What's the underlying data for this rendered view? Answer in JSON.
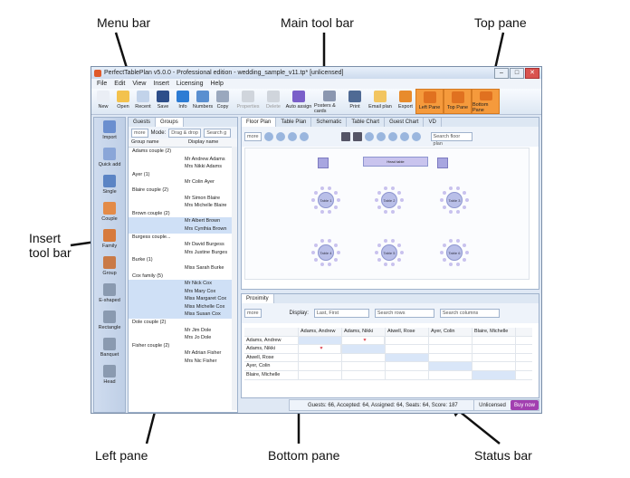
{
  "callouts": {
    "menu_bar": "Menu bar",
    "main_tool_bar": "Main tool bar",
    "top_pane": "Top pane",
    "insert_tool_bar_1": "Insert",
    "insert_tool_bar_2": "tool bar",
    "left_pane": "Left pane",
    "bottom_pane": "Bottom pane",
    "status_bar": "Status bar"
  },
  "window": {
    "title": "PerfectTablePlan v5.0.0 - Professional edition - wedding_sample_v11.tp* [unlicensed]"
  },
  "menu": [
    "File",
    "Edit",
    "View",
    "Insert",
    "Licensing",
    "Help"
  ],
  "toolbar": [
    {
      "label": "New",
      "color": "#eaeef5"
    },
    {
      "label": "Open",
      "color": "#f3c24d"
    },
    {
      "label": "Recent",
      "color": "#c2d3ea"
    },
    {
      "label": "Save",
      "color": "#2d4e8a"
    },
    {
      "label": "Info",
      "color": "#2d7cd4"
    },
    {
      "label": "Numbers",
      "color": "#5a8fd0"
    },
    {
      "label": "Copy",
      "color": "#9aa8be"
    },
    {
      "label": "Properties",
      "color": "#d0d5dc"
    },
    {
      "label": "Delete",
      "color": "#d0d5dc"
    },
    {
      "label": "Auto assign",
      "color": "#7a5fc9"
    },
    {
      "label": "Posters & cards",
      "color": "#8b97b0"
    },
    {
      "label": "Print",
      "color": "#4f6a94"
    },
    {
      "label": "Email plan",
      "color": "#f2c560"
    },
    {
      "label": "Export",
      "color": "#e88b2c"
    },
    {
      "label": "Left Pane",
      "color": "#e07120"
    },
    {
      "label": "Top Pane",
      "color": "#e07120"
    },
    {
      "label": "Bottom Pane",
      "color": "#e07120"
    }
  ],
  "insert_tools": [
    "Import",
    "Quick add",
    "Single",
    "Couple",
    "Family",
    "Group",
    "E-shaped",
    "Rectangle",
    "Banquet",
    "Head"
  ],
  "left": {
    "tabs": [
      "Guests",
      "Groups"
    ],
    "mode_label": "Mode:",
    "mode_value": "Drag & drop",
    "search_placeholder": "Search g",
    "more": "more",
    "columns": [
      "Group name",
      "Display name"
    ],
    "rows": [
      {
        "type": "group",
        "text": "Adams couple (2)"
      },
      {
        "type": "guest",
        "text": "Mr Andrew Adams"
      },
      {
        "type": "guest",
        "text": "Mrs Nikki Adams"
      },
      {
        "type": "group",
        "text": "Ayer (1)"
      },
      {
        "type": "guest",
        "text": "Mr Colin Ayer"
      },
      {
        "type": "group",
        "text": "Blaire couple (2)"
      },
      {
        "type": "guest",
        "text": "Mr Simon Blaire"
      },
      {
        "type": "guest",
        "text": "Mrs Michelle Blaire"
      },
      {
        "type": "group",
        "text": "Brown couple (2)"
      },
      {
        "type": "guest",
        "text": "Mr Albert Brown"
      },
      {
        "type": "guest",
        "text": "Mrs Cynthia Brown"
      },
      {
        "type": "group",
        "text": "Burgess couple..."
      },
      {
        "type": "guest",
        "text": "Mr David Burgess"
      },
      {
        "type": "guest",
        "text": "Mrs Justine Burges"
      },
      {
        "type": "group",
        "text": "Burke (1)"
      },
      {
        "type": "guest",
        "text": "Miss Sarah Burke"
      },
      {
        "type": "group",
        "text": "Cox family (5)"
      },
      {
        "type": "guest",
        "text": "Mr Nick Cox"
      },
      {
        "type": "guest",
        "text": "Mrs Mary Cox"
      },
      {
        "type": "guest",
        "text": "Miss Margaret Cox"
      },
      {
        "type": "guest",
        "text": "Miss Michelle Cox"
      },
      {
        "type": "guest",
        "text": "Miss Susan Cox"
      },
      {
        "type": "group",
        "text": "Dole couple (2)"
      },
      {
        "type": "guest",
        "text": "Mr Jim Dole"
      },
      {
        "type": "guest",
        "text": "Mrs Jo Dole"
      },
      {
        "type": "group",
        "text": "Fisher couple (2)"
      },
      {
        "type": "guest",
        "text": "Mr Adrian Fisher"
      },
      {
        "type": "guest",
        "text": "Mrs Nic Fisher"
      }
    ]
  },
  "top": {
    "tabs": [
      "Floor Plan",
      "Table Plan",
      "Schematic",
      "Table Chart",
      "Guest Chart",
      "VD"
    ],
    "more": "more",
    "search_placeholder": "Search floor plan",
    "head_table": "Head table",
    "tables": [
      "Table 1",
      "Table 2",
      "Table 3",
      "Table 4",
      "Table 5",
      "Table 6"
    ]
  },
  "bottom": {
    "tab": "Proximity",
    "more": "more",
    "display_label": "Display:",
    "display_value": "Last, First",
    "search_rows": "Search rows",
    "search_cols": "Search columns",
    "columns": [
      "Adams, Andrew",
      "Adams, Nikki",
      "Atwell, Rose",
      "Ayer, Colin",
      "Blaire, Michelle"
    ],
    "rows": [
      "Adams, Andrew",
      "Adams, Nikki",
      "Atwell, Rose",
      "Ayer, Colin",
      "Blaire, Michelle"
    ]
  },
  "status": {
    "text": "Guests: 66, Accepted: 64, Assigned: 64, Seats: 64, Score: 187",
    "license": "Unlicensed",
    "buy": "Buy now"
  }
}
